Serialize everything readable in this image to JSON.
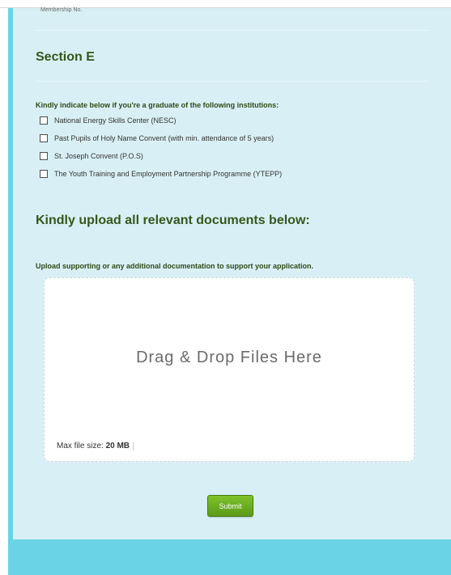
{
  "form": {
    "membership_label": "Membership No.",
    "section_title": "Section E",
    "graduate_question": "Kindly indicate below if you're a graduate of the following institutions:",
    "institutions": [
      "National Energy Skills Center (NESC)",
      "Past Pupils of Holy Name Convent (with min. attendance of 5 years)",
      "St. Joseph Convent (P.O.S)",
      "The Youth Training and Employment Partnership Programme (YTEPP)"
    ],
    "upload_heading": "Kindly upload all relevant documents below:",
    "upload_instructions": "Upload supporting or any additional documentation to support your application.",
    "dropzone_text": "Drag & Drop Files Here",
    "max_size_label": "Max file size:",
    "max_size_value": "20 MB",
    "submit_label": "Submit"
  },
  "colors": {
    "frame": "#6ad3e6",
    "panel": "#d8f0f5",
    "heading": "#35571b",
    "submit": "#6cb022"
  }
}
